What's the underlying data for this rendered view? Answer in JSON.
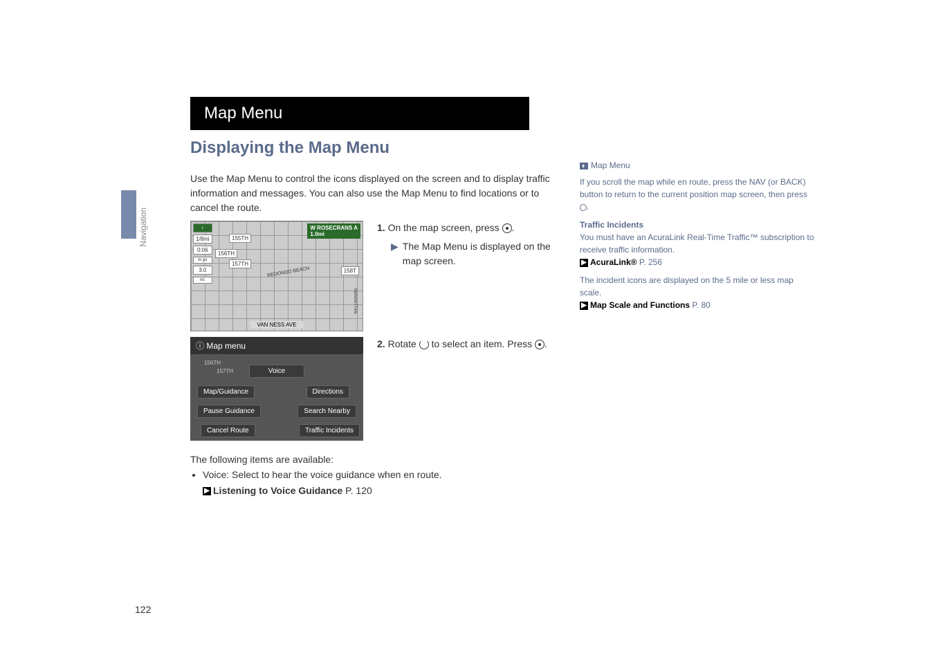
{
  "title": "Map Menu",
  "subtitle": "Displaying the Map Menu",
  "intro": "Use the Map Menu to control the icons displayed on the screen and to display traffic information and messages. You can also use the Map Menu to find locations or to cancel the route.",
  "side_label": "Navigation",
  "steps": {
    "s1num": "1.",
    "s1text": "On the map screen, press ",
    "s1sub": "The Map Menu is displayed on the map screen.",
    "s2num": "2.",
    "s2text_a": "Rotate ",
    "s2text_b": " to select an item. Press "
  },
  "map1": {
    "sign": "W ROSECRANS A",
    "mi": "1.0mi",
    "scale": "1/8mi",
    "togo_min": "0:06",
    "togo_lbl": "to go",
    "dist": "3.0",
    "dist_unit": "mi.",
    "r155": "155TH",
    "r156": "156TH",
    "r157": "157TH",
    "r158": "158T",
    "beach": "REDONDO BEACH",
    "bottom": "VAN NESS AVE",
    "manhattan": "MANHATTAN"
  },
  "menu": {
    "header_icon": "ⓘ",
    "header": "Map menu",
    "voice": "Voice",
    "mapguidance": "Map/Guidance",
    "directions": "Directions",
    "pause": "Pause Guidance",
    "search": "Search Nearby",
    "cancel": "Cancel Route",
    "traffic": "Traffic Incidents",
    "bg_157": "157TH"
  },
  "footer": {
    "following": "The following items are available:",
    "voice_label": "Voice:",
    "voice_desc": " Select to hear the voice guidance when en route.",
    "link": "Listening to Voice Guidance",
    "link_pg": " P. 120"
  },
  "sidebar": {
    "title": "Map Menu",
    "p1": "If you scroll the map while en route, press the NAV (or BACK) button to return to the current position map screen, then press ",
    "traffic_h": "Traffic Incidents",
    "traffic_p": "You must have an AcuraLink Real-Time Traffic™ subscription to receive traffic information.",
    "acura": "AcuraLink®",
    "acura_pg": " P. 256",
    "incident": "The incident icons are displayed on the 5 mile or less map scale.",
    "scale": "Map Scale and Functions",
    "scale_pg": " P. 80"
  },
  "page": "122"
}
